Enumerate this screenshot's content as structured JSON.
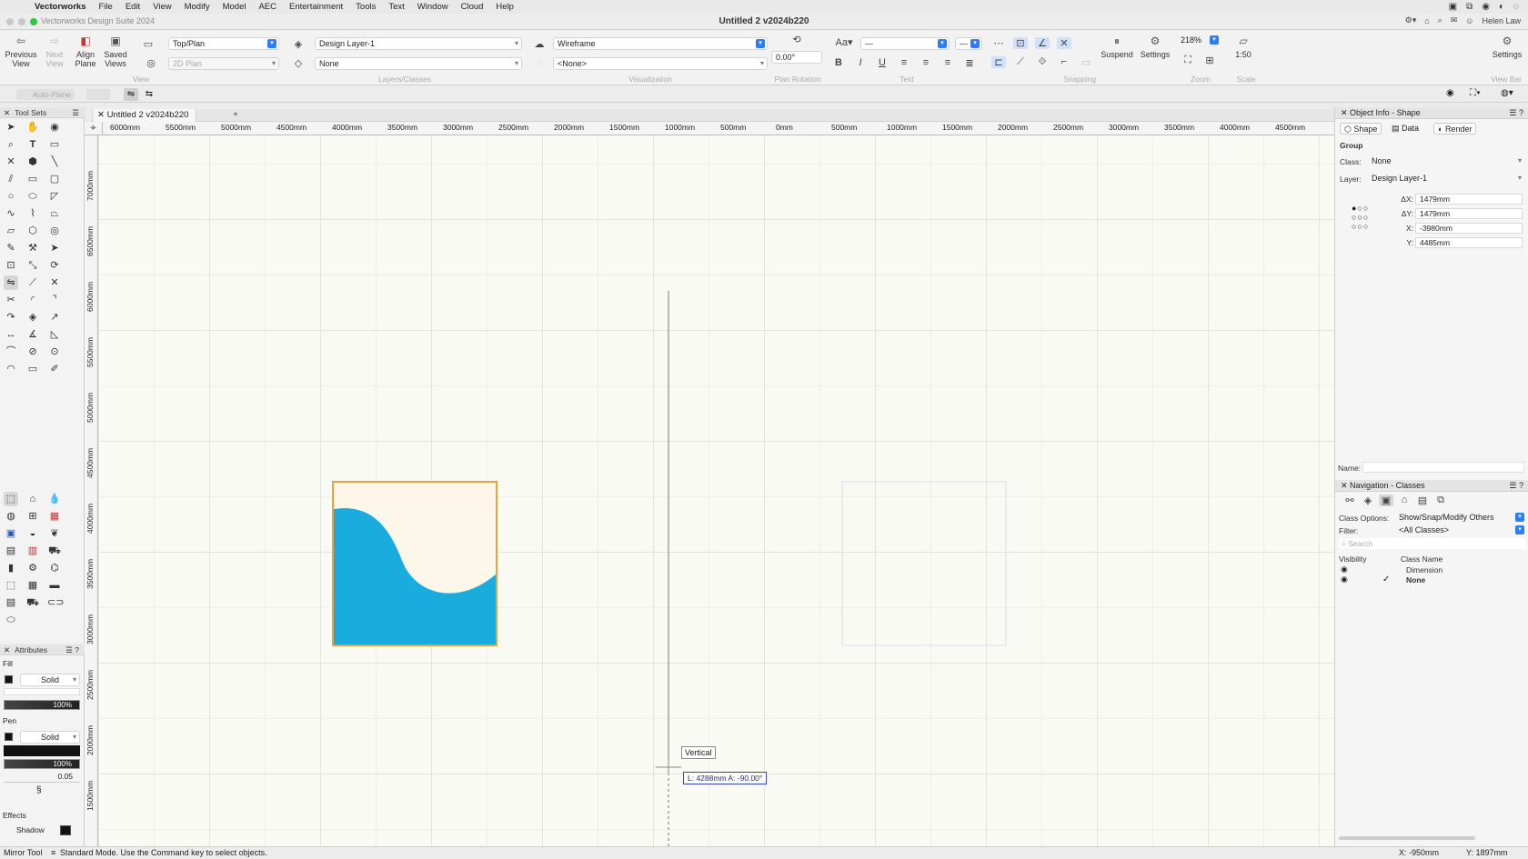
{
  "menubar": {
    "app": "Vectorworks",
    "items": [
      "File",
      "Edit",
      "View",
      "Modify",
      "Model",
      "AEC",
      "Entertainment",
      "Tools",
      "Text",
      "Window",
      "Cloud",
      "Help"
    ]
  },
  "window": {
    "suite": "Vectorworks Design Suite 2024",
    "document": "Untitled 2 v2024b220",
    "user": "Helen Law"
  },
  "toolbar": {
    "previous_view": "Previous View",
    "next_view": "Next View",
    "align_plane": "Align Plane",
    "saved_views": "Saved Views",
    "view_dd": "Top/Plan",
    "view2_dd": "2D Plan",
    "layer_dd": "Design Layer-1",
    "class_dd": "None",
    "render_dd": "Wireframe",
    "none_dd": "<None>",
    "rotation": "0.00°",
    "font_dd": "---",
    "size_dd": "---",
    "suspend": "Suspend",
    "settings": "Settings",
    "zoom": "218%",
    "scale": "1:50",
    "settings_right": "Settings",
    "groups": {
      "view": "View",
      "layers": "Layers/Classes",
      "visualization": "Visualization",
      "plan_rotation": "Plan Rotation",
      "text": "Text",
      "snapping": "Snapping",
      "zoom": "Zoom",
      "scale": "Scale",
      "view_bar": "View Bar"
    },
    "auto_plane": "Auto-Plane"
  },
  "toolsets": {
    "title": "Tool Sets"
  },
  "attributes": {
    "title": "Attributes",
    "fill_label": "Fill",
    "fill_style": "Solid",
    "fill_opacity": "100%",
    "pen_label": "Pen",
    "pen_style": "Solid",
    "pen_opacity": "100%",
    "pen_weight": "0.05",
    "effects_label": "Effects",
    "shadow_label": "Shadow"
  },
  "tab": {
    "name": "Untitled 2 v2024b220"
  },
  "ruler": {
    "h": [
      "6000mm",
      "5500mm",
      "5000mm",
      "4500mm",
      "4000mm",
      "3500mm",
      "3000mm",
      "2500mm",
      "2000mm",
      "1500mm",
      "1000mm",
      "500mm",
      "0mm",
      "500mm",
      "1000mm",
      "1500mm",
      "2000mm",
      "2500mm",
      "3000mm",
      "3500mm",
      "4000mm",
      "4500mm"
    ],
    "v": [
      "7000mm",
      "6500mm",
      "6000mm",
      "5500mm",
      "5000mm",
      "4500mm",
      "4000mm",
      "3500mm",
      "3000mm",
      "2500mm",
      "2000mm",
      "1500mm"
    ]
  },
  "canvas": {
    "snap_tip": "Vertical",
    "measure": "L:  4288mm    A:  -90.00°",
    "wave_fill": "#1aacdc",
    "wave_bg": "#fdf7ea",
    "selection_color": "#e8a33c"
  },
  "objinfo": {
    "title": "Object Info - Shape",
    "tab_shape": "Shape",
    "tab_data": "Data",
    "tab_render": "Render",
    "kind": "Group",
    "class_label": "Class:",
    "class_value": "None",
    "layer_label": "Layer:",
    "layer_value": "Design Layer-1",
    "dx_label": "ΔX:",
    "dx_value": "1479mm",
    "dy_label": "ΔY:",
    "dy_value": "1479mm",
    "x_label": "X:",
    "x_value": "-3980mm",
    "y_label": "Y:",
    "y_value": "4485mm",
    "name_label": "Name:"
  },
  "navclasses": {
    "title": "Navigation - Classes",
    "options_label": "Class Options:",
    "options_value": "Show/Snap/Modify Others",
    "filter_label": "Filter:",
    "filter_value": "<All Classes>",
    "search_placeholder": "Search",
    "col_visibility": "Visibility",
    "col_name": "Class Name",
    "rows": [
      "Dimension",
      "None"
    ]
  },
  "status": {
    "tool": "Mirror Tool",
    "message": "Standard Mode. Use the Command key to select objects.",
    "x": "X: -950mm",
    "y": "Y: 1897mm"
  }
}
